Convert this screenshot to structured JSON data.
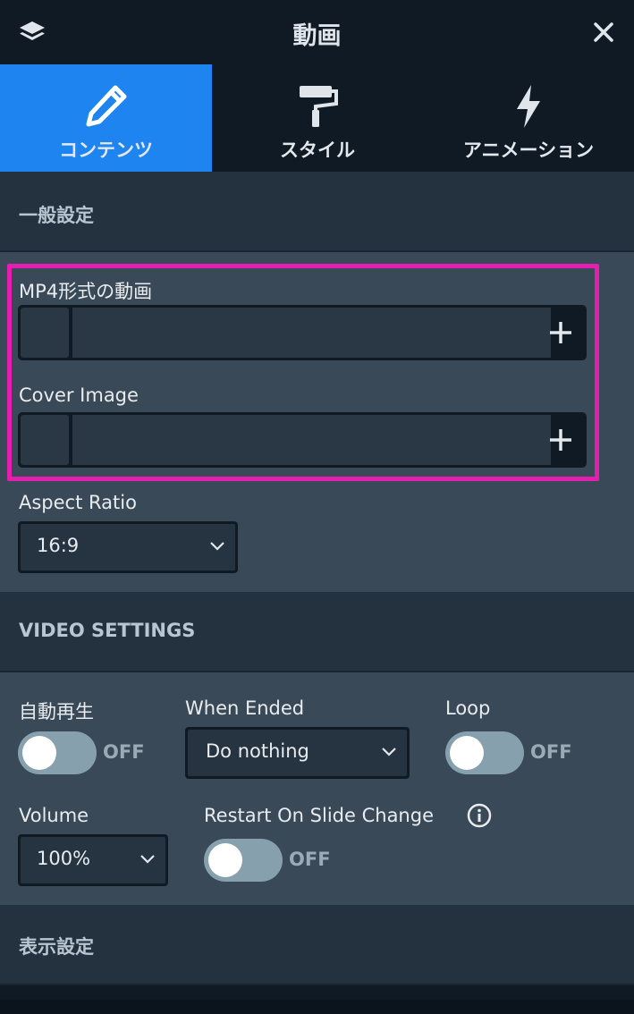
{
  "header": {
    "title": "動画",
    "left_icon": "layers-icon",
    "right_icon": "close-icon"
  },
  "tabs": [
    {
      "label": "コンテンツ",
      "icon": "pencil-icon",
      "active": true
    },
    {
      "label": "スタイル",
      "icon": "paint-roller-icon",
      "active": false
    },
    {
      "label": "アニメーション",
      "icon": "lightning-icon",
      "active": false
    }
  ],
  "general": {
    "section_title": "一般設定",
    "mp4_label": "MP4形式の動画",
    "mp4_value": "",
    "cover_label": "Cover Image",
    "cover_value": "",
    "aspect_label": "Aspect Ratio",
    "aspect_value": "16:9"
  },
  "video_settings": {
    "section_title": "VIDEO SETTINGS",
    "autoplay": {
      "label": "自動再生",
      "state": "OFF"
    },
    "when_ended": {
      "label": "When Ended",
      "value": "Do nothing"
    },
    "loop": {
      "label": "Loop",
      "state": "OFF"
    },
    "volume": {
      "label": "Volume",
      "value": "100%"
    },
    "restart": {
      "label": "Restart On Slide Change",
      "state": "OFF",
      "icon": "info-icon"
    }
  },
  "display": {
    "section_title": "表示設定"
  },
  "colors": {
    "accent": "#1e84f0",
    "highlight": "#e41fb0",
    "header_bg": "#0f1a25",
    "panel_bg": "#3a4957",
    "section_bg": "#243240"
  }
}
